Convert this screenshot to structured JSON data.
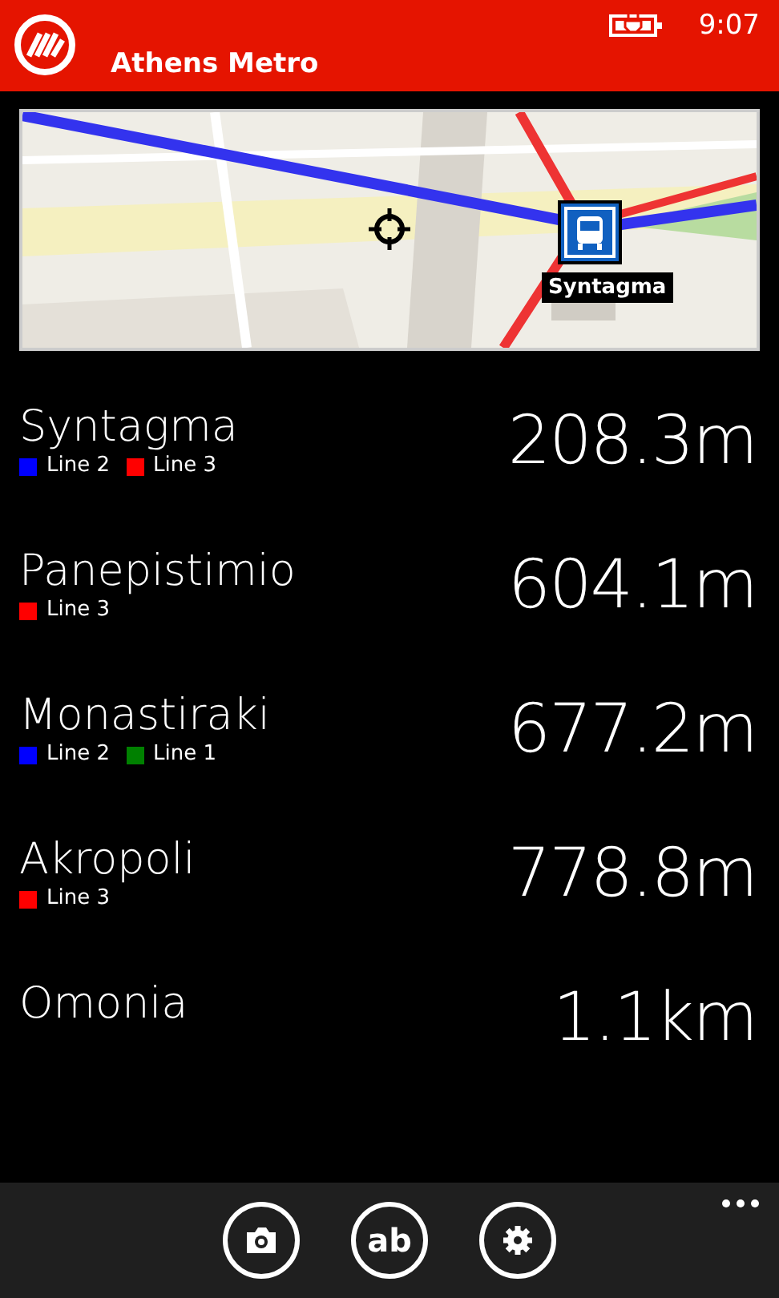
{
  "status_bar": {
    "time": "9:07"
  },
  "header": {
    "title": "Athens Metro"
  },
  "map": {
    "pin_label": "Syntagma"
  },
  "stations": [
    {
      "name": "Syntagma",
      "distance": "208.3m",
      "lines": [
        {
          "label": "Line 2",
          "color": "#0000ff"
        },
        {
          "label": "Line 3",
          "color": "#ff0000"
        }
      ]
    },
    {
      "name": "Panepistimio",
      "distance": "604.1m",
      "lines": [
        {
          "label": "Line 3",
          "color": "#ff0000"
        }
      ]
    },
    {
      "name": "Monastiraki",
      "distance": "677.2m",
      "lines": [
        {
          "label": "Line 2",
          "color": "#0000ff"
        },
        {
          "label": "Line 1",
          "color": "#008000"
        }
      ]
    },
    {
      "name": "Akropoli",
      "distance": "778.8m",
      "lines": [
        {
          "label": "Line 3",
          "color": "#ff0000"
        }
      ]
    },
    {
      "name": "Omonia",
      "distance": "1.1km"
    }
  ],
  "app_bar": {
    "buttons": [
      {
        "kind": "camera"
      },
      {
        "kind": "text",
        "label": "ab"
      },
      {
        "kind": "settings"
      }
    ]
  }
}
